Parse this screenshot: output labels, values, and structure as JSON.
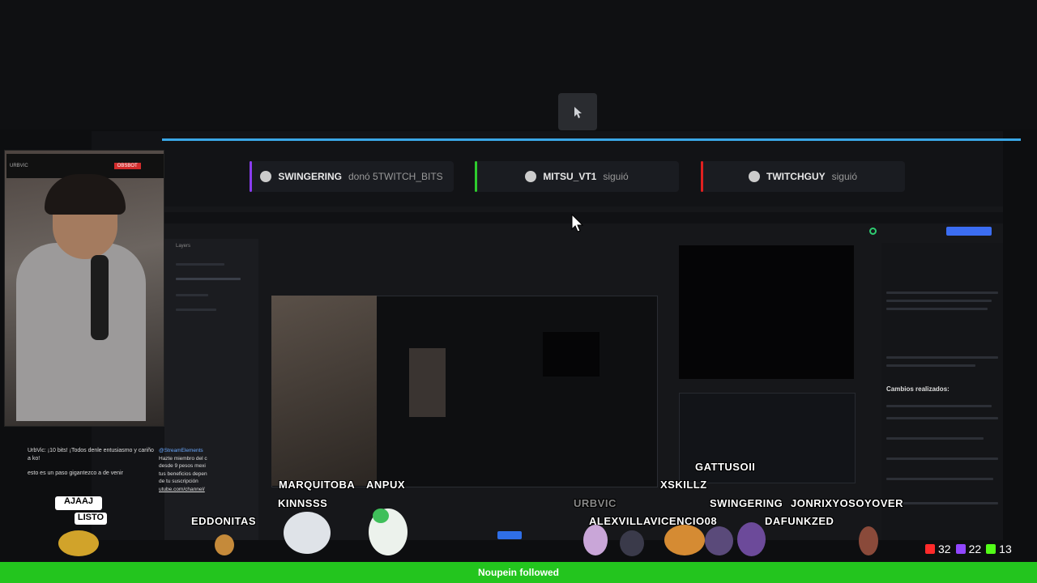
{
  "alerts": [
    {
      "user": "SWINGERING",
      "action": "donó 5TWITCH_BITS",
      "color": "#8a3cf0"
    },
    {
      "user": "MITSU_VT1",
      "action": "siguió",
      "color": "#2ecc2e"
    },
    {
      "user": "TWITCHGUY",
      "action": "siguió",
      "color": "#e02020"
    }
  ],
  "webcam_hud": {
    "channel": "URBVIC",
    "badge": "OBSBOT"
  },
  "chat": {
    "line1": "UrbVic: ¡10 bits! ¡Todos denle entusiasmo y cariño a ko!",
    "line2": "esto es un paso gigantezco a de venir"
  },
  "chat_panel": {
    "header": "@StreamElements",
    "body": "Hazte miembro del c desde 9 pesos mexi tus beneficios depen de tu suscripción",
    "link": "utube.com/channel/"
  },
  "bubbles": [
    "AJAAJ",
    "LISTO"
  ],
  "names": {
    "marquitoba": "MARQUITOBA",
    "anpux": "ANPUX",
    "kinnsss": "KINNSSS",
    "eddonitas": "EDDONITAS",
    "gattusoii": "GATTUSOII",
    "xskillz": "XSKILLZ",
    "urbvic": "URBVIC",
    "swingering": "SWINGERING",
    "jonrix": "JONRIXYOSOYOVER",
    "alexvilla": "ALEXVILLAVICENCIO08",
    "dafunkzed": "DAFUNKZED"
  },
  "editor": {
    "sidebar_title": "Layers",
    "right_heading": "Cambios realizados:"
  },
  "counts": {
    "youtube": "32",
    "twitch": "22",
    "kick": "13"
  },
  "colors": {
    "youtube": "#ff2a2a",
    "twitch": "#9146ff",
    "kick": "#53fc18",
    "follow_bar": "#23c51e"
  },
  "follow_notice": "Noupein followed"
}
